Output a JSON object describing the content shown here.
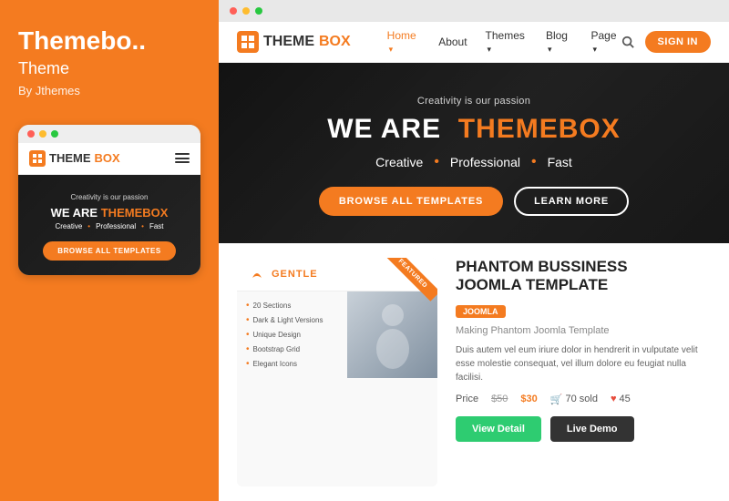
{
  "left": {
    "title": "Themebo..",
    "subtitle": "Theme",
    "author": "By Jthemes",
    "dots": [
      "red",
      "yellow",
      "green"
    ],
    "mobile_logo_theme": "THEME",
    "mobile_logo_box": "BOX",
    "passion_text": "Creativity is our passion",
    "we_are": "WE ARE",
    "themebox": "THEMEBOX",
    "tagline_creative": "Creative",
    "tagline_professional": "Professional",
    "tagline_fast": "Fast",
    "browse_btn": "BROWSE ALL TEMPLATES"
  },
  "right": {
    "browser_dots": [
      "red",
      "yellow",
      "green"
    ],
    "nav": {
      "logo_theme": "THEME",
      "logo_box": "BOX",
      "links": [
        "Home",
        "About",
        "Themes",
        "Blog",
        "Page"
      ],
      "active": "Home",
      "signin": "SIGN IN"
    },
    "hero": {
      "passion": "Creativity is our passion",
      "headline_we": "WE ARE",
      "headline_brand": "THEMEBOX",
      "creative": "Creative",
      "professional": "Professional",
      "fast": "Fast",
      "btn_browse": "BROWSE ALL TEMPLATES",
      "btn_learn": "LEARN MORE"
    },
    "product": {
      "gentle_label": "GENTLE",
      "features": [
        "20 Sections",
        "Dark & Light Versions",
        "Unique Design",
        "Bootstrap Grid",
        "Elegant Icons"
      ],
      "title_line1": "PHANTOM BUSSINESS",
      "title_line2": "JOOMLA TEMPLATE",
      "badge": "JOOMLA",
      "making": "Making Phantom Joomla Template",
      "desc": "Duis autem vel eum iriure dolor in hendrerit in vulputate velit esse molestie consequat, vel illum dolore eu feugiat nulla facilisi.",
      "price_label": "Price",
      "old_price": "$50",
      "new_price": "$30",
      "sold": "70 sold",
      "likes": "45",
      "btn_detail": "View Detail",
      "btn_demo": "Live Demo",
      "ribbon": "FEATURED"
    }
  }
}
